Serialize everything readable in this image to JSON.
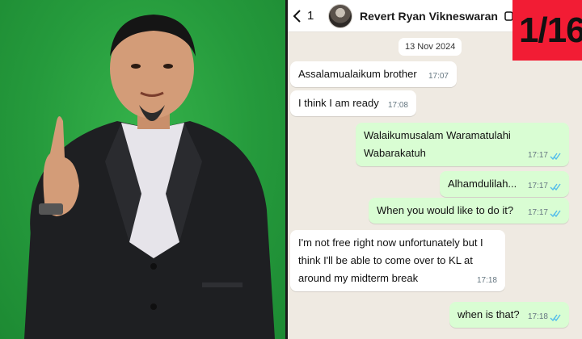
{
  "badge": "1/16",
  "chat": {
    "header": {
      "unread": "1",
      "contact_name": "Revert Ryan Vikneswaran"
    },
    "date_separator": "13 Nov 2024",
    "messages": [
      {
        "direction": "in",
        "text": "Assalamualaikum brother",
        "time": "17:07"
      },
      {
        "direction": "in",
        "text": "I think I am ready",
        "time": "17:08"
      },
      {
        "direction": "out",
        "text": "Walaikumusalam Waramatulahi Wabarakatuh",
        "time": "17:17",
        "status": "read"
      },
      {
        "direction": "out",
        "text": "Alhamdulilah...",
        "time": "17:17",
        "status": "read"
      },
      {
        "direction": "out",
        "text": "When you would like to do it?",
        "time": "17:17",
        "status": "read"
      },
      {
        "direction": "in",
        "text": "I'm not free right now unfortunately but I think I'll be able to come over to KL at around my midterm break",
        "time": "17:18"
      },
      {
        "direction": "out",
        "text": "when is that?",
        "time": "17:18",
        "status": "read"
      }
    ]
  },
  "colors": {
    "green_screen": "#259a3c",
    "chat_background": "#efeae2",
    "outgoing_bubble": "#d9fdd3",
    "incoming_bubble": "#ffffff",
    "read_ticks": "#53bdeb",
    "badge": "#f21c34"
  }
}
